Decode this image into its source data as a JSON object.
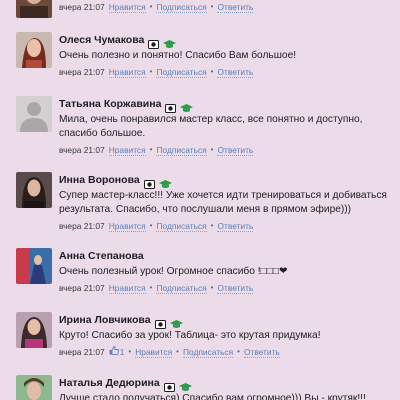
{
  "actions": {
    "like": "Нравится",
    "subscribe": "Подписаться",
    "reply": "Ответить",
    "separator": "•"
  },
  "comments": [
    {
      "name": "",
      "text": "",
      "date": "вчера 21:07"
    },
    {
      "name": "Олеся Чумакова",
      "text": "Очень полезно и понятно! Спасибо Вам большое!",
      "date": "вчера 21:07"
    },
    {
      "name": "Татьяна Коржавина",
      "text": "Мила, очень понравился мастер класс, все понятно и доступно, спасибо большое.",
      "date": "вчера 21:07"
    },
    {
      "name": "Инна Воронова",
      "text": "Супер мастер-класс!!! Уже хочется идти тренироваться и добиваться результата. Спасибо, что послушали меня в прямом эфире)))",
      "date": "вчера 21:07"
    },
    {
      "name": "Анна Степанова",
      "text": "Очень полезный урок! Огромное спасибо !□□□❤",
      "date": "вчера 21:07"
    },
    {
      "name": "Ирина Ловчикова",
      "text": "Круто! Спасибо за урок! Таблица- это крутая придумка!",
      "date": "вчера 21:07",
      "like_count": "1"
    },
    {
      "name": "Наталья Дедюрина",
      "text": "Лучше стало получаться) Спасибо вам огромное))) Вы - крутяк!!!"
    }
  ],
  "colors": {
    "background": "#ecdcea",
    "link": "#5a7fb8",
    "badge_green": "#2c9b4a",
    "badge_dark": "#1e1e1e"
  },
  "icons": {
    "verified": "id-card-icon",
    "graduate": "graduation-cap-icon",
    "like": "thumbs-up-icon"
  }
}
